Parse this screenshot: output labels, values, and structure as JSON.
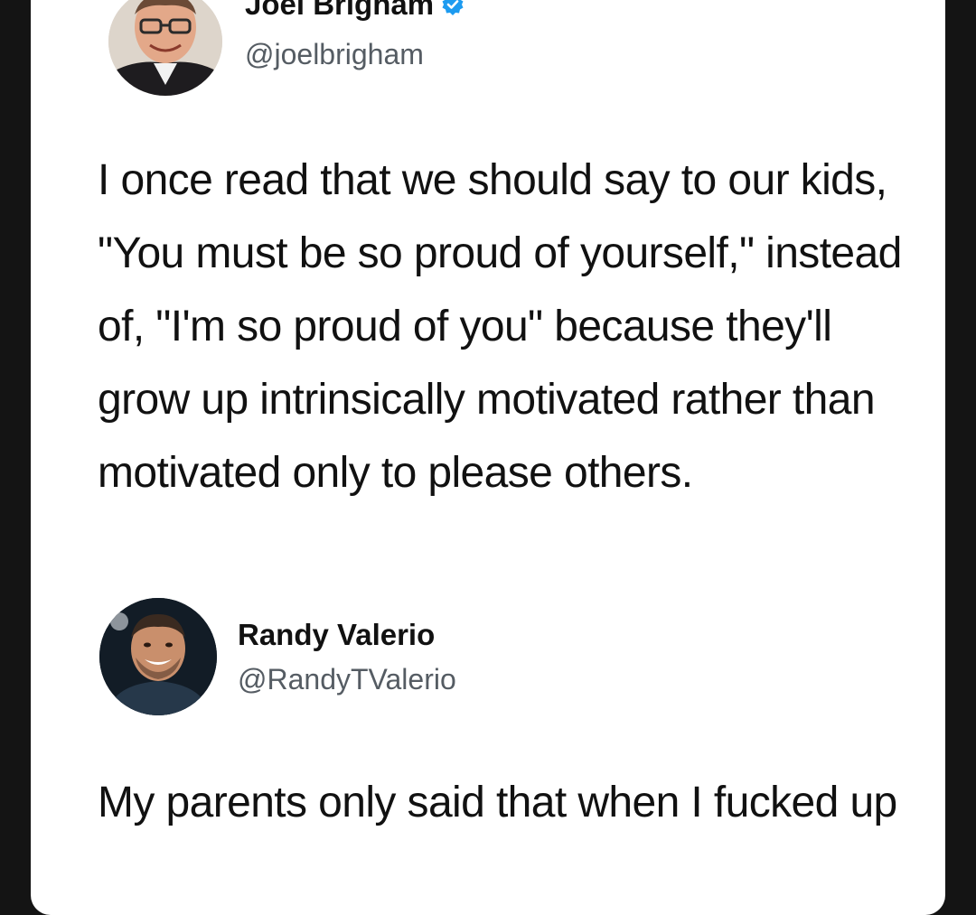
{
  "tweets": [
    {
      "display_name": "Joel Brigham",
      "handle": "@joelbrigham",
      "verified": true,
      "verified_icon": "verified-badge-icon",
      "verified_color": "#1d9bf0",
      "avatar_icon": "profile-photo",
      "text": "I once read that we should say to our kids, \"You must be so proud of yourself,\" instead of, \"I'm so proud of you\" because they'll grow up intrinsically motivated rather than motivated only to please others."
    },
    {
      "display_name": "Randy Valerio",
      "handle": "@RandyTValerio",
      "verified": false,
      "avatar_icon": "profile-photo",
      "text": "My parents only said that when I fucked up"
    }
  ],
  "colors": {
    "background": "#141414",
    "card": "#ffffff",
    "text": "#111111",
    "handle": "#555c63"
  }
}
